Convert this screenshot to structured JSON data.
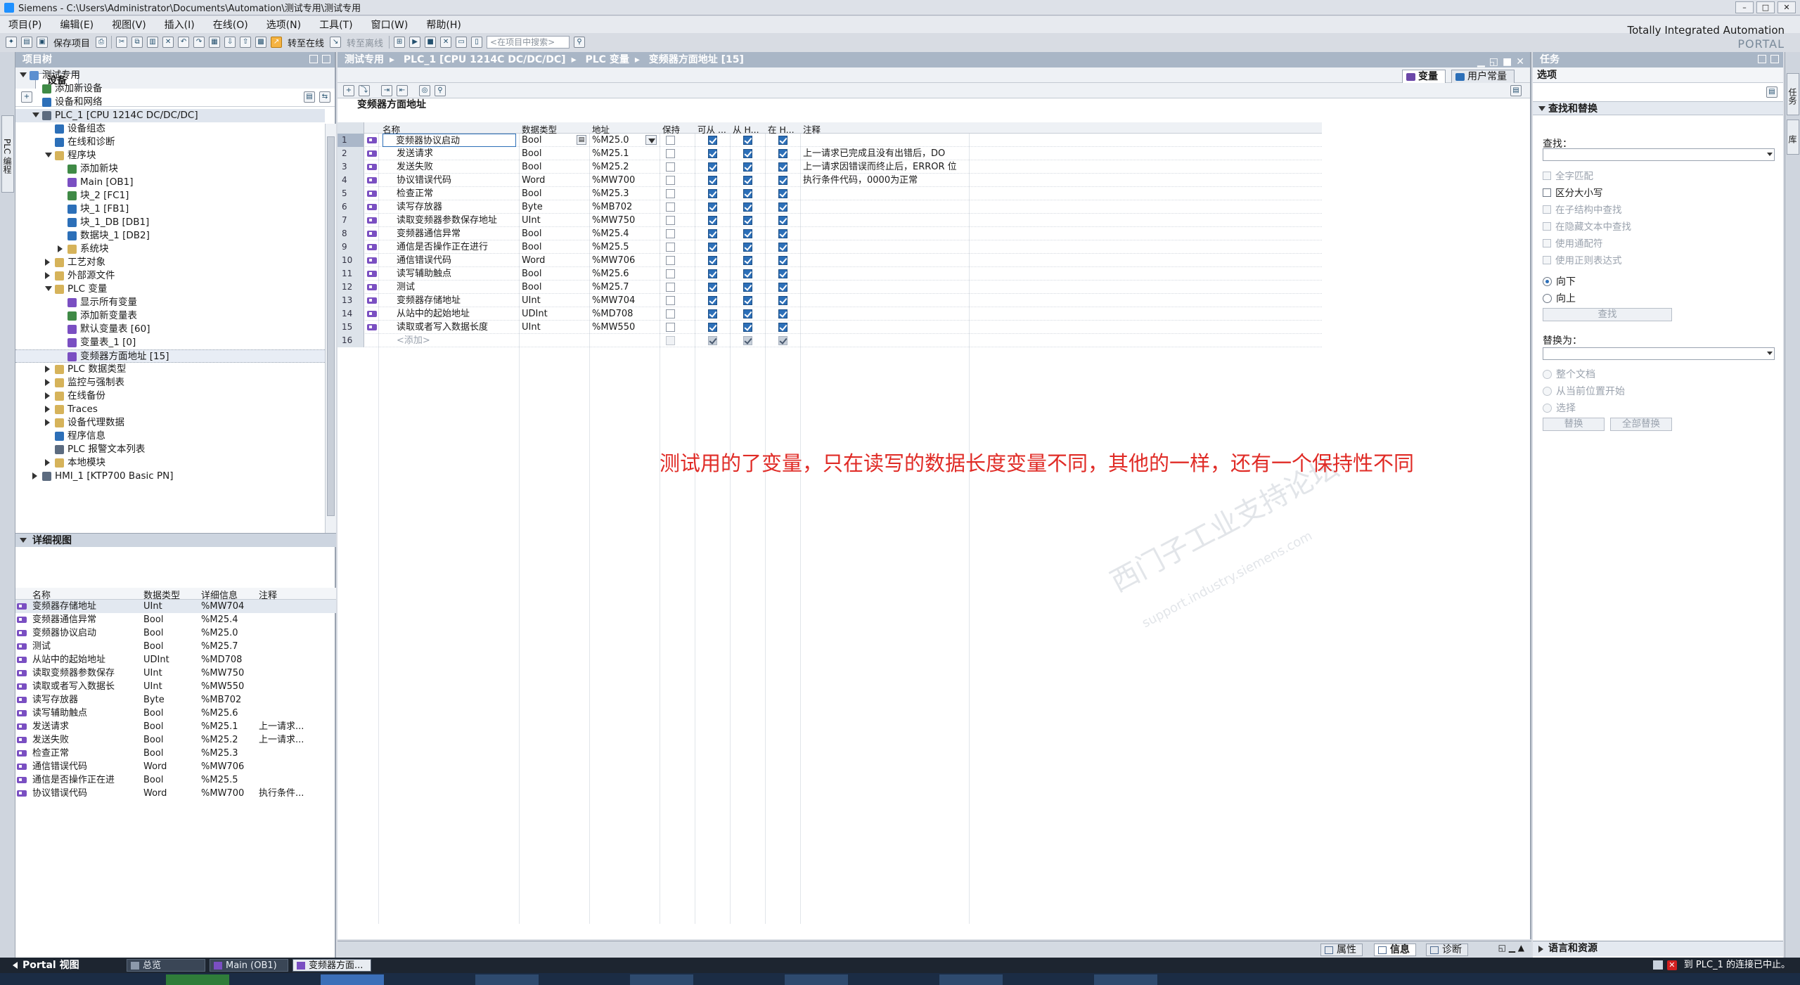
{
  "window": {
    "title": "Siemens  -  C:\\Users\\Administrator\\Documents\\Automation\\测试专用\\测试专用",
    "brand_line1": "Totally Integrated Automation",
    "brand_line2": "PORTAL"
  },
  "menu": [
    "项目(P)",
    "编辑(E)",
    "视图(V)",
    "插入(I)",
    "在线(O)",
    "选项(N)",
    "工具(T)",
    "窗口(W)",
    "帮助(H)"
  ],
  "toolbar": {
    "save_project": "保存项目",
    "go_online": "转至在线",
    "go_offline": "转至离线",
    "search_placeholder": "<在项目中搜索>"
  },
  "left_panel": {
    "title": "项目树",
    "tab": "设备",
    "side_tab": "PLC 编程",
    "tree": [
      {
        "label": "测试专用",
        "level": 0,
        "state": "open",
        "icon": "project-icon"
      },
      {
        "label": "添加新设备",
        "level": 1,
        "state": "none",
        "icon": "add-device-icon"
      },
      {
        "label": "设备和网络",
        "level": 1,
        "state": "none",
        "icon": "network-icon"
      },
      {
        "label": "PLC_1 [CPU 1214C DC/DC/DC]",
        "level": 1,
        "state": "open",
        "icon": "plc-icon",
        "selected": true
      },
      {
        "label": "设备组态",
        "level": 2,
        "state": "none",
        "icon": "device-config-icon"
      },
      {
        "label": "在线和诊断",
        "level": 2,
        "state": "none",
        "icon": "diagnostics-icon"
      },
      {
        "label": "程序块",
        "level": 2,
        "state": "open",
        "icon": "folder-icon"
      },
      {
        "label": "添加新块",
        "level": 3,
        "state": "none",
        "icon": "add-block-icon"
      },
      {
        "label": "Main [OB1]",
        "level": 3,
        "state": "none",
        "icon": "ob-icon"
      },
      {
        "label": "块_2 [FC1]",
        "level": 3,
        "state": "none",
        "icon": "fc-icon"
      },
      {
        "label": "块_1 [FB1]",
        "level": 3,
        "state": "none",
        "icon": "fb-icon"
      },
      {
        "label": "块_1_DB [DB1]",
        "level": 3,
        "state": "none",
        "icon": "db-icon"
      },
      {
        "label": "数据块_1 [DB2]",
        "level": 3,
        "state": "none",
        "icon": "db-icon"
      },
      {
        "label": "系统块",
        "level": 3,
        "state": "closed",
        "icon": "folder-icon"
      },
      {
        "label": "工艺对象",
        "level": 2,
        "state": "closed",
        "icon": "folder-icon"
      },
      {
        "label": "外部源文件",
        "level": 2,
        "state": "closed",
        "icon": "folder-icon"
      },
      {
        "label": "PLC 变量",
        "level": 2,
        "state": "open",
        "icon": "folder-icon"
      },
      {
        "label": "显示所有变量",
        "level": 3,
        "state": "none",
        "icon": "tag-table-icon"
      },
      {
        "label": "添加新变量表",
        "level": 3,
        "state": "none",
        "icon": "add-tag-table-icon"
      },
      {
        "label": "默认变量表 [60]",
        "level": 3,
        "state": "none",
        "icon": "tag-table-icon"
      },
      {
        "label": "变量表_1 [0]",
        "level": 3,
        "state": "none",
        "icon": "tag-table-icon"
      },
      {
        "label": "变频器方面地址 [15]",
        "level": 3,
        "state": "none",
        "icon": "tag-table-icon",
        "highlighted": true
      },
      {
        "label": "PLC 数据类型",
        "level": 2,
        "state": "closed",
        "icon": "folder-icon"
      },
      {
        "label": "监控与强制表",
        "level": 2,
        "state": "closed",
        "icon": "folder-icon"
      },
      {
        "label": "在线备份",
        "level": 2,
        "state": "closed",
        "icon": "folder-icon"
      },
      {
        "label": "Traces",
        "level": 2,
        "state": "closed",
        "icon": "folder-icon"
      },
      {
        "label": "设备代理数据",
        "level": 2,
        "state": "closed",
        "icon": "folder-icon"
      },
      {
        "label": "程序信息",
        "level": 2,
        "state": "none",
        "icon": "info-icon"
      },
      {
        "label": "PLC 报警文本列表",
        "level": 2,
        "state": "none",
        "icon": "alarm-text-icon"
      },
      {
        "label": "本地模块",
        "level": 2,
        "state": "closed",
        "icon": "folder-icon"
      },
      {
        "label": "HMI_1 [KTP700 Basic PN]",
        "level": 1,
        "state": "closed",
        "icon": "hmi-icon"
      }
    ]
  },
  "detail_view": {
    "title": "详细视图",
    "columns": [
      "名称",
      "数据类型",
      "详细信息",
      "注释"
    ],
    "rows": [
      {
        "name": "变频器存储地址",
        "type": "UInt",
        "detail": "%MW704",
        "comment": ""
      },
      {
        "name": "变频器通信异常",
        "type": "Bool",
        "detail": "%M25.4",
        "comment": ""
      },
      {
        "name": "变频器协议启动",
        "type": "Bool",
        "detail": "%M25.0",
        "comment": ""
      },
      {
        "name": "测试",
        "type": "Bool",
        "detail": "%M25.7",
        "comment": ""
      },
      {
        "name": "从站中的起始地址",
        "type": "UDInt",
        "detail": "%MD708",
        "comment": ""
      },
      {
        "name": "读取变频器参数保存",
        "type": "UInt",
        "detail": "%MW750",
        "comment": ""
      },
      {
        "name": "读取或者写入数据长",
        "type": "UInt",
        "detail": "%MW550",
        "comment": ""
      },
      {
        "name": "读写存放器",
        "type": "Byte",
        "detail": "%MB702",
        "comment": ""
      },
      {
        "name": "读写辅助触点",
        "type": "Bool",
        "detail": "%M25.6",
        "comment": ""
      },
      {
        "name": "发送请求",
        "type": "Bool",
        "detail": "%M25.1",
        "comment": "上一请求..."
      },
      {
        "name": "发送失败",
        "type": "Bool",
        "detail": "%M25.2",
        "comment": "上一请求..."
      },
      {
        "name": "检查正常",
        "type": "Bool",
        "detail": "%M25.3",
        "comment": ""
      },
      {
        "name": "通信错误代码",
        "type": "Word",
        "detail": "%MW706",
        "comment": ""
      },
      {
        "name": "通信是否操作正在进",
        "type": "Bool",
        "detail": "%M25.5",
        "comment": ""
      },
      {
        "name": "协议错误代码",
        "type": "Word",
        "detail": "%MW700",
        "comment": "执行条件..."
      }
    ]
  },
  "editor": {
    "breadcrumb": [
      "测试专用",
      "PLC_1 [CPU 1214C DC/DC/DC]",
      "PLC 变量",
      "变频器方面地址 [15]"
    ],
    "tab_tags": "变量",
    "tab_constants": "用户常量",
    "table_title": "变频器方面地址",
    "columns": [
      "名称",
      "数据类型",
      "地址",
      "保持",
      "可从 ...",
      "从 H...",
      "在 H...",
      "注释"
    ],
    "rows": [
      {
        "no": "1",
        "name": "变频器协议启动",
        "type": "Bool",
        "addr": "%M25.0",
        "retain": false,
        "acc": true,
        "hmi": true,
        "vis": true,
        "comment": ""
      },
      {
        "no": "2",
        "name": "发送请求",
        "type": "Bool",
        "addr": "%M25.1",
        "retain": false,
        "acc": true,
        "hmi": true,
        "vis": true,
        "comment": "上一请求已完成且没有出错后，DO"
      },
      {
        "no": "3",
        "name": "发送失败",
        "type": "Bool",
        "addr": "%M25.2",
        "retain": false,
        "acc": true,
        "hmi": true,
        "vis": true,
        "comment": "上一请求因错误而终止后，ERROR 位"
      },
      {
        "no": "4",
        "name": "协议错误代码",
        "type": "Word",
        "addr": "%MW700",
        "retain": false,
        "acc": true,
        "hmi": true,
        "vis": true,
        "comment": "执行条件代码，0000为正常"
      },
      {
        "no": "5",
        "name": "检查正常",
        "type": "Bool",
        "addr": "%M25.3",
        "retain": false,
        "acc": true,
        "hmi": true,
        "vis": true,
        "comment": ""
      },
      {
        "no": "6",
        "name": "读写存放器",
        "type": "Byte",
        "addr": "%MB702",
        "retain": false,
        "acc": true,
        "hmi": true,
        "vis": true,
        "comment": ""
      },
      {
        "no": "7",
        "name": "读取变频器参数保存地址",
        "type": "UInt",
        "addr": "%MW750",
        "retain": false,
        "acc": true,
        "hmi": true,
        "vis": true,
        "comment": ""
      },
      {
        "no": "8",
        "name": "变频器通信异常",
        "type": "Bool",
        "addr": "%M25.4",
        "retain": false,
        "acc": true,
        "hmi": true,
        "vis": true,
        "comment": ""
      },
      {
        "no": "9",
        "name": "通信是否操作正在进行",
        "type": "Bool",
        "addr": "%M25.5",
        "retain": false,
        "acc": true,
        "hmi": true,
        "vis": true,
        "comment": ""
      },
      {
        "no": "10",
        "name": "通信错误代码",
        "type": "Word",
        "addr": "%MW706",
        "retain": false,
        "acc": true,
        "hmi": true,
        "vis": true,
        "comment": ""
      },
      {
        "no": "11",
        "name": "读写辅助触点",
        "type": "Bool",
        "addr": "%M25.6",
        "retain": false,
        "acc": true,
        "hmi": true,
        "vis": true,
        "comment": ""
      },
      {
        "no": "12",
        "name": "测试",
        "type": "Bool",
        "addr": "%M25.7",
        "retain": false,
        "acc": true,
        "hmi": true,
        "vis": true,
        "comment": ""
      },
      {
        "no": "13",
        "name": "变频器存储地址",
        "type": "UInt",
        "addr": "%MW704",
        "retain": false,
        "acc": true,
        "hmi": true,
        "vis": true,
        "comment": ""
      },
      {
        "no": "14",
        "name": "从站中的起始地址",
        "type": "UDInt",
        "addr": "%MD708",
        "retain": false,
        "acc": true,
        "hmi": true,
        "vis": true,
        "comment": ""
      },
      {
        "no": "15",
        "name": "读取或者写入数据长度",
        "type": "UInt",
        "addr": "%MW550",
        "retain": false,
        "acc": true,
        "hmi": true,
        "vis": true,
        "comment": ""
      }
    ],
    "add_row": {
      "no": "16",
      "label": "<添加>"
    },
    "annotation": "测试用的了变量，只在读写的数据长度变量不同，其他的一样，还有一个保持性不同",
    "watermark": "西门子工业支持论坛",
    "watermark_url": "support.industry.siemens.com",
    "bottom_tabs": [
      "属性",
      "信息",
      "诊断"
    ]
  },
  "tasks": {
    "title": "任务",
    "options": "选项",
    "section_find": "查找和替换",
    "find_label": "查找：",
    "chk": [
      "全字匹配",
      "区分大小写",
      "在子结构中查找",
      "在隐藏文本中查找",
      "使用通配符",
      "使用正则表达式"
    ],
    "dir_down": "向下",
    "dir_up": "向上",
    "find_btn": "查找",
    "replace_label": "替换为：",
    "scope": [
      "整个文档",
      "从当前位置开始",
      "选择"
    ],
    "replace_btn": "替换",
    "replace_all_btn": "全部替换",
    "section_lang": "语言和资源",
    "side_tabs": [
      "任务",
      "库"
    ]
  },
  "footer": {
    "portal": "Portal 视图",
    "tabs": [
      "总览",
      "Main (OB1)",
      "变频器方面..."
    ],
    "status": "到 PLC_1 的连接已中止。"
  }
}
